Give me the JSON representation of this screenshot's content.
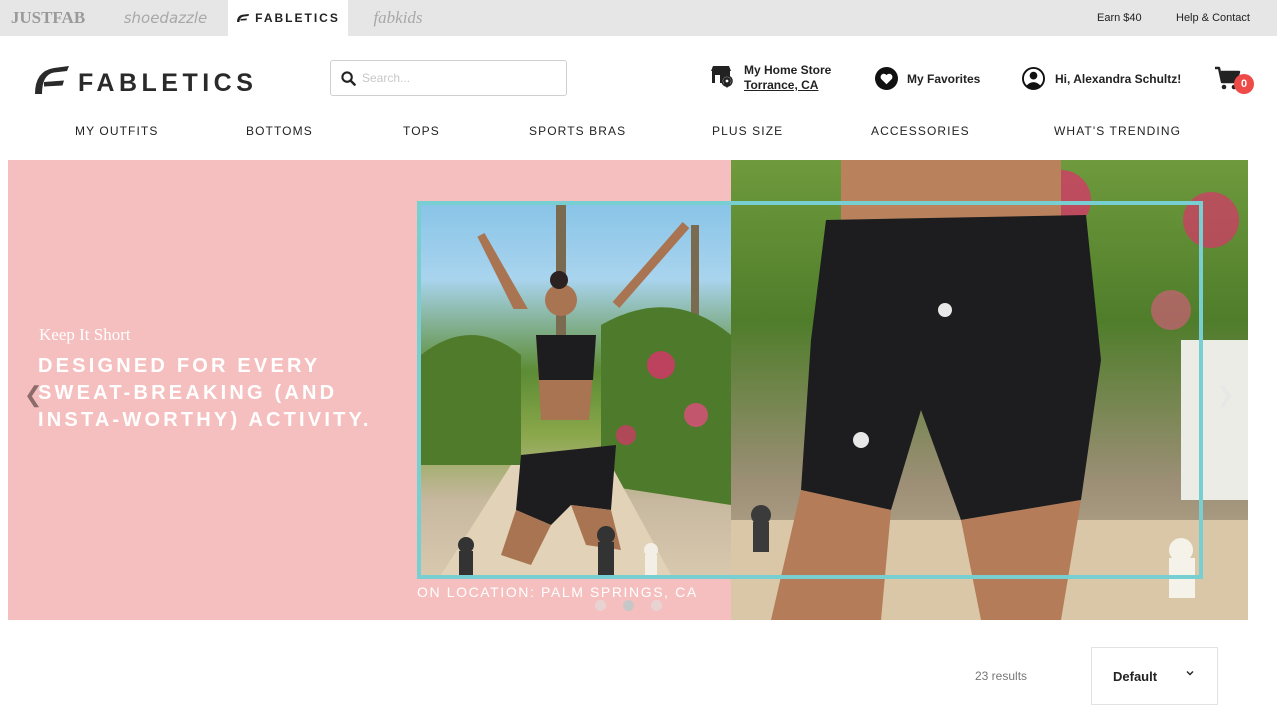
{
  "brands": {
    "justfab": "JUSTFAB",
    "shoedazzle": "shoedazzle",
    "fabletics": "FABLETICS",
    "fabkids": "fabkids"
  },
  "topbar": {
    "earn": "Earn $40",
    "help": "Help & Contact"
  },
  "header": {
    "logo_text": "FABLETICS",
    "search_placeholder": "Search...",
    "store_label": "My Home Store",
    "store_location": "Torrance, CA",
    "favorites_label": "My Favorites",
    "greeting": "Hi, Alexandra Schultz!",
    "cart_count": "0"
  },
  "nav": {
    "items": [
      "MY OUTFITS",
      "BOTTOMS",
      "TOPS",
      "SPORTS BRAS",
      "PLUS SIZE",
      "ACCESSORIES",
      "WHAT'S TRENDING"
    ]
  },
  "hero": {
    "eyebrow": "Keep It Short",
    "headline": "DESIGNED FOR EVERY SWEAT-BREAKING (AND INSTA-WORTHY) ACTIVITY.",
    "caption": "ON LOCATION: PALM SPRINGS, CA",
    "slides": 3,
    "active_slide": 2
  },
  "listing": {
    "results": "23 results",
    "sort_selected": "Default"
  },
  "colors": {
    "hero_pink": "#f6bfbf",
    "frame_teal": "#78cfd2",
    "cart_badge": "#ee4a47"
  }
}
